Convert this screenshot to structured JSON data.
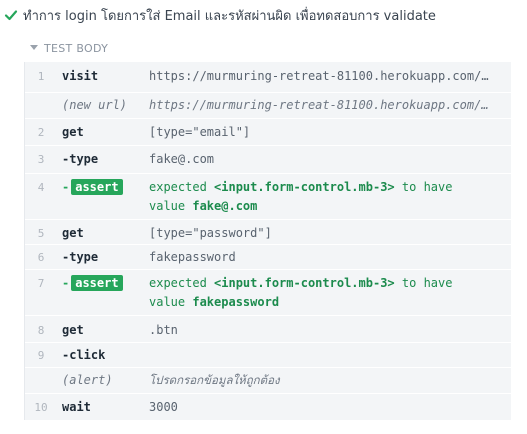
{
  "test": {
    "status_color": "#26a65b",
    "title": "ทำการ login โดยการใส่ Email และรหัสผ่านผิด เพื่อทดสอบการ validate"
  },
  "section": {
    "label": "TEST BODY",
    "icon": "caret-down-icon"
  },
  "commands": [
    {
      "num": "1",
      "name": "visit",
      "message": "https://murmuring-retreat-81100.herokuapp.com/…"
    },
    {
      "num": "",
      "name": "(new url)",
      "message": "https://murmuring-retreat-81100.herokuapp.com/…"
    },
    {
      "num": "2",
      "name": "get",
      "message": "[type=\"email\"]"
    },
    {
      "num": "3",
      "name": "-type",
      "message": "fake@.com"
    },
    {
      "num": "4",
      "name": "assert",
      "expected_prefix": "expected",
      "subject": "<input.form-control.mb-3>",
      "to_have": "to have",
      "value_word": "value",
      "value": "fake@.com"
    },
    {
      "num": "5",
      "name": "get",
      "message": "[type=\"password\"]"
    },
    {
      "num": "6",
      "name": "-type",
      "message": "fakepassword"
    },
    {
      "num": "7",
      "name": "assert",
      "expected_prefix": "expected",
      "subject": "<input.form-control.mb-3>",
      "to_have": "to have",
      "value_word": "value",
      "value": "fakepassword"
    },
    {
      "num": "8",
      "name": "get",
      "message": ".btn"
    },
    {
      "num": "9",
      "name": "-click",
      "message": ""
    },
    {
      "num": "",
      "name": "(alert)",
      "message": "โปรดกรอกข้อมูลให้ถูกต้อง"
    },
    {
      "num": "10",
      "name": "wait",
      "message": "3000"
    }
  ]
}
